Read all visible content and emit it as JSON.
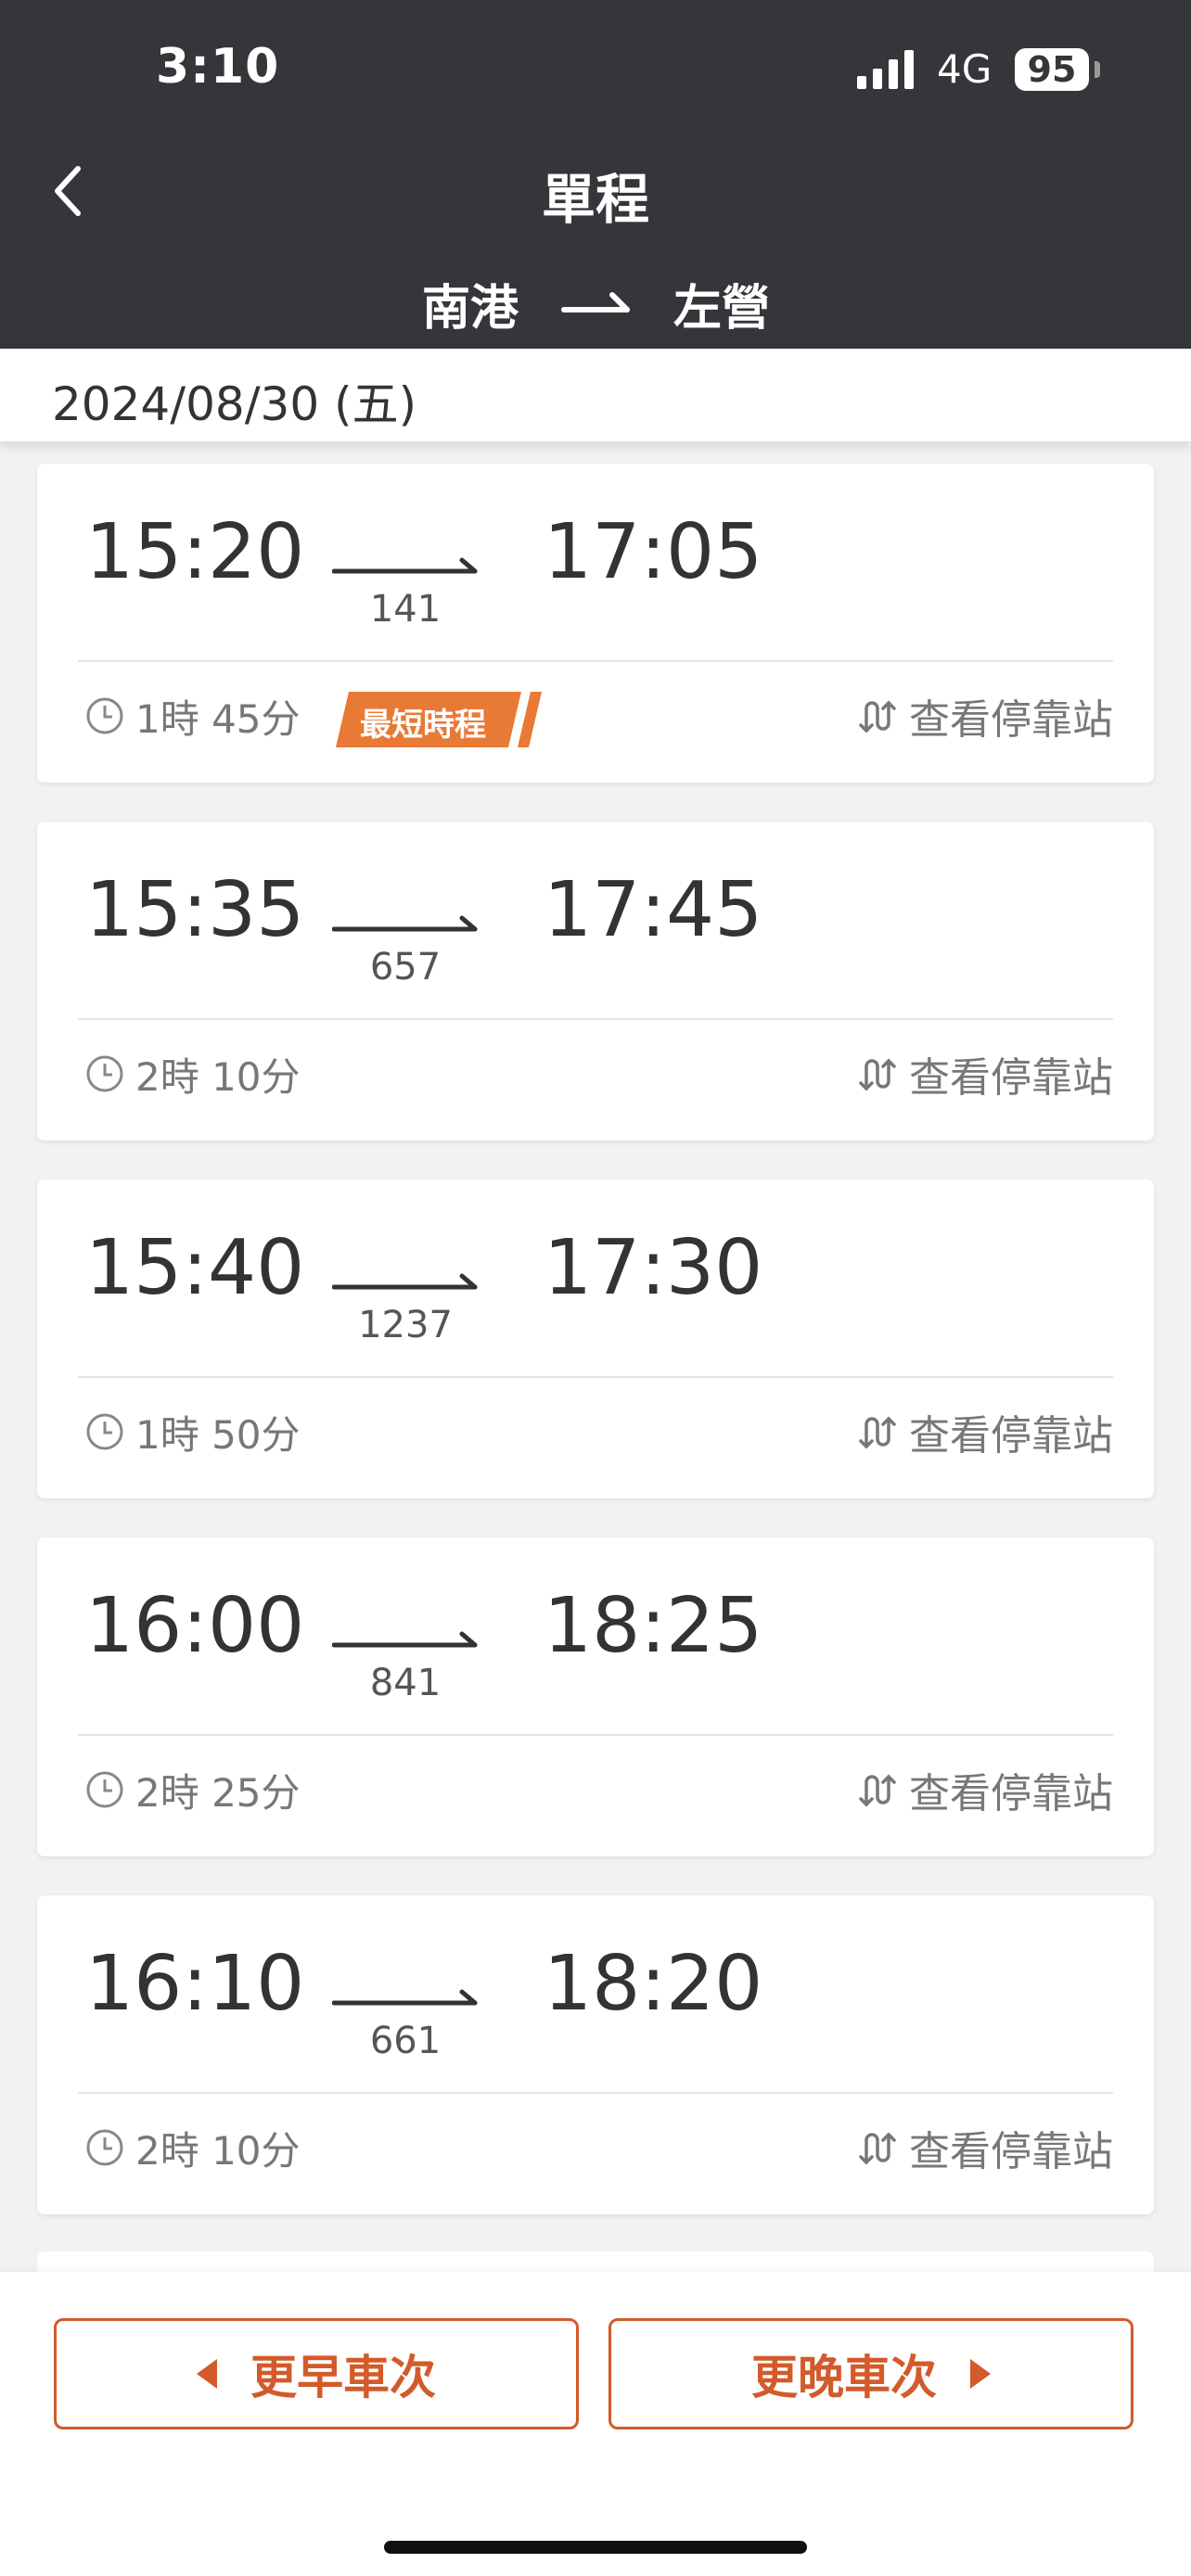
{
  "status_bar": {
    "time": "3:10",
    "network": "4G",
    "battery": "95"
  },
  "header": {
    "title": "單程",
    "from": "南港",
    "to": "左營"
  },
  "date": "2024/08/30 (五)",
  "trains": [
    {
      "departure": "15:20",
      "arrival": "17:05",
      "number": "141",
      "duration": "1時 45分",
      "badge": "最短時程",
      "stops_label": "查看停靠站"
    },
    {
      "departure": "15:35",
      "arrival": "17:45",
      "number": "657",
      "duration": "2時 10分",
      "stops_label": "查看停靠站"
    },
    {
      "departure": "15:40",
      "arrival": "17:30",
      "number": "1237",
      "duration": "1時 50分",
      "stops_label": "查看停靠站"
    },
    {
      "departure": "16:00",
      "arrival": "18:25",
      "number": "841",
      "duration": "2時 25分",
      "stops_label": "查看停靠站"
    },
    {
      "departure": "16:10",
      "arrival": "18:20",
      "number": "661",
      "duration": "2時 10分",
      "stops_label": "查看停靠站"
    }
  ],
  "buttons": {
    "earlier": "更早車次",
    "later": "更晚車次"
  },
  "colors": {
    "header_bg": "#35363a",
    "accent": "#d35a2a",
    "badge": "#e87a36"
  }
}
